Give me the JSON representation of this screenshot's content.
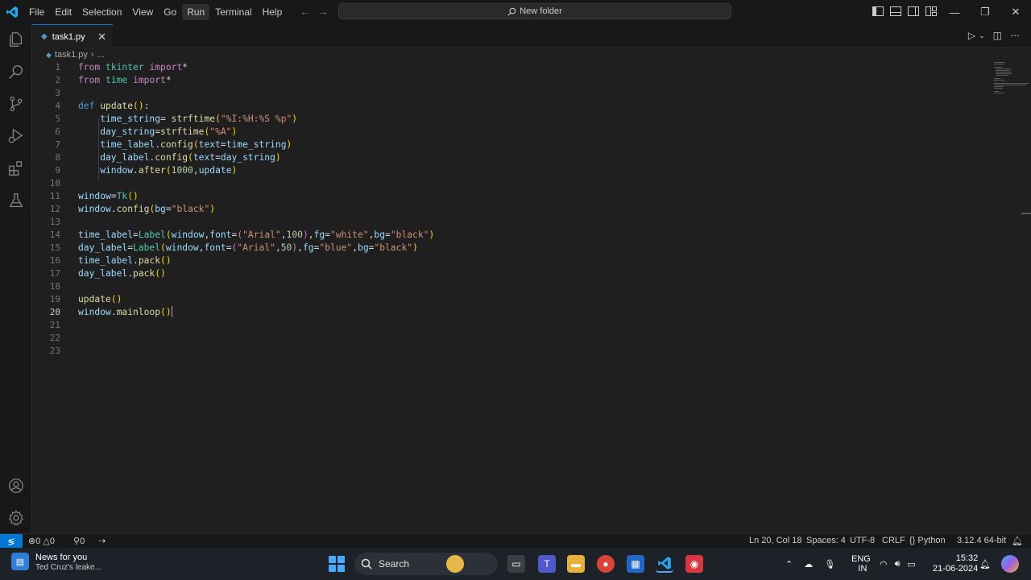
{
  "menu": [
    "File",
    "Edit",
    "Selection",
    "View",
    "Go",
    "Run",
    "Terminal",
    "Help"
  ],
  "menu_active": "Run",
  "command_center": "New folder",
  "tab": {
    "name": "task1.py",
    "icon": "python-icon"
  },
  "breadcrumb": {
    "file": "task1.py",
    "sep": "›",
    "more": "..."
  },
  "editor": {
    "current_line": 20,
    "lines": [
      {
        "n": "1"
      },
      {
        "n": "2"
      },
      {
        "n": "3"
      },
      {
        "n": "4"
      },
      {
        "n": "5"
      },
      {
        "n": "6"
      },
      {
        "n": "7"
      },
      {
        "n": "8"
      },
      {
        "n": "9"
      },
      {
        "n": "10"
      },
      {
        "n": "11"
      },
      {
        "n": "12"
      },
      {
        "n": "13"
      },
      {
        "n": "14"
      },
      {
        "n": "15"
      },
      {
        "n": "16"
      },
      {
        "n": "17"
      },
      {
        "n": "18"
      },
      {
        "n": "19"
      },
      {
        "n": "20"
      },
      {
        "n": "21"
      },
      {
        "n": "22"
      },
      {
        "n": "23"
      }
    ]
  },
  "status": {
    "errors": "0",
    "warnings": "0",
    "ports": "0",
    "position": "Ln 20, Col 18",
    "spaces": "Spaces: 4",
    "encoding": "UTF-8",
    "eol": "CRLF",
    "language": "Python",
    "interpreter": "3.12.4 64-bit"
  },
  "taskbar": {
    "news_title": "News for you",
    "news_sub": "Ted Cruz's leake...",
    "search": "Search",
    "lang1": "ENG",
    "lang2": "IN",
    "time": "15:32",
    "date": "21-06-2024"
  },
  "colors": {
    "accent": "#0078d4",
    "keyword": "#c586c0",
    "string": "#ce9178",
    "function": "#dcdcaa"
  }
}
